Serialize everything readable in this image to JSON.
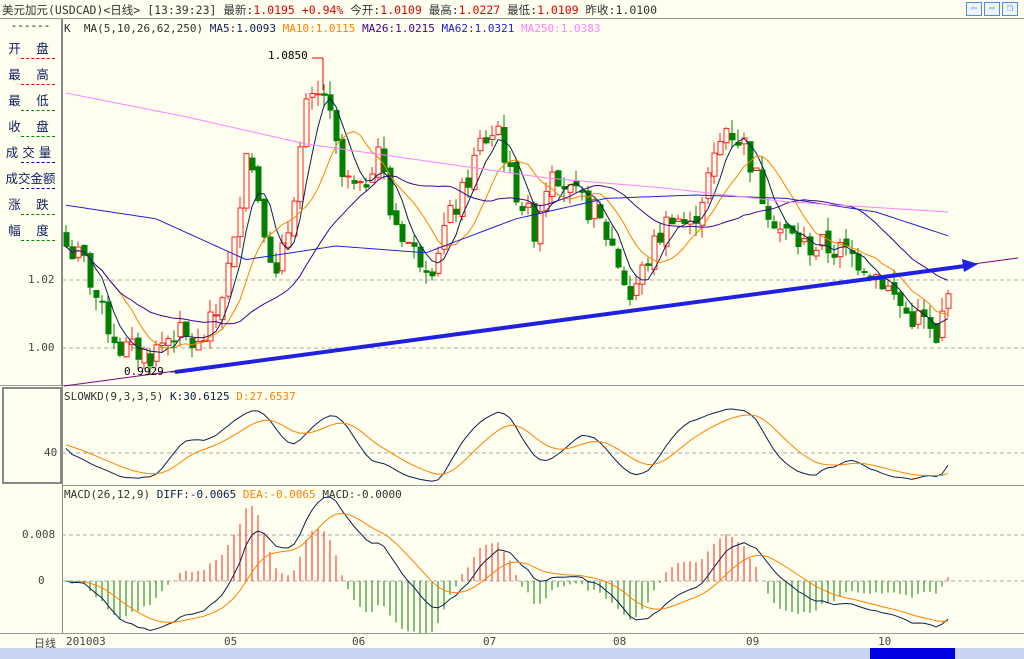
{
  "title": {
    "name": "美元加元(USDCAD)<日线>",
    "time": "[13:39:23]",
    "latest_label": "最新:",
    "latest": "1.0195",
    "change": "+0.94%",
    "open_label": "今开:",
    "open": "1.0109",
    "high_label": "最高:",
    "high": "1.0227",
    "low_label": "最低:",
    "low": "1.0109",
    "prev_label": "昨收:",
    "prev": "1.0100"
  },
  "nav": {
    "back": "⇦",
    "forward": "⇨",
    "restore": "❐"
  },
  "left_panel": {
    "dash": "------",
    "items": [
      "开 盘",
      "最 高",
      "最 低",
      "收 盘",
      "成交量",
      "成交金额",
      "涨 跌",
      "幅 度"
    ]
  },
  "main_legend": {
    "k": "K",
    "ma": "MA(5,10,26,62,250)",
    "ma5": "MA5:1.0093",
    "ma10": "MA10:1.0115",
    "ma26": "MA26:1.0215",
    "ma62": "MA62:1.0321",
    "ma250": "MA250:1.0383"
  },
  "price_axis": [
    "1.02",
    "1.00"
  ],
  "annotations": {
    "high": "1.0850",
    "low": "0.9929"
  },
  "kd": {
    "legend": "SLOWKD(9,3,3,5)",
    "k": "K:30.6125",
    "d": "D:27.6537",
    "axis": "40"
  },
  "macd": {
    "legend": "MACD(26,12,9)",
    "diff": "DIFF:-0.0065",
    "dea": "DEA:-0.0065",
    "macd": "MACD:-0.0000",
    "axis": [
      "0.008",
      "0"
    ]
  },
  "date_axis": {
    "label": "日线",
    "ticks": [
      "201003",
      "05",
      "06",
      "07",
      "08",
      "09",
      "10"
    ]
  },
  "colors": {
    "up": "#ff2020",
    "down": "#008000",
    "ma5": "#0a2050",
    "ma10": "#ff8000",
    "ma26": "#400090",
    "ma62": "#2020d0",
    "ma250": "#ff80ff",
    "trend": "#2020e0"
  },
  "chart_data": {
    "type": "candlestick",
    "close_keypoints": [
      [
        0,
        1.03
      ],
      [
        3,
        1.025
      ],
      [
        6,
        1.01
      ],
      [
        9,
        1.0
      ],
      [
        14,
        0.998
      ],
      [
        18,
        1.005
      ],
      [
        22,
        1.0
      ],
      [
        25,
        1.01
      ],
      [
        28,
        1.03
      ],
      [
        30,
        1.06
      ],
      [
        32,
        1.045
      ],
      [
        35,
        1.02
      ],
      [
        37,
        1.035
      ],
      [
        40,
        1.07
      ],
      [
        43,
        1.075
      ],
      [
        46,
        1.05
      ],
      [
        49,
        1.045
      ],
      [
        52,
        1.06
      ],
      [
        54,
        1.04
      ],
      [
        58,
        1.028
      ],
      [
        61,
        1.025
      ],
      [
        63,
        1.035
      ],
      [
        66,
        1.045
      ],
      [
        69,
        1.06
      ],
      [
        72,
        1.065
      ],
      [
        74,
        1.05
      ],
      [
        78,
        1.035
      ],
      [
        81,
        1.055
      ],
      [
        84,
        1.045
      ],
      [
        88,
        1.04
      ],
      [
        91,
        1.03
      ],
      [
        94,
        1.015
      ],
      [
        98,
        1.03
      ],
      [
        101,
        1.04
      ],
      [
        104,
        1.035
      ],
      [
        107,
        1.05
      ],
      [
        110,
        1.065
      ],
      [
        113,
        1.06
      ],
      [
        116,
        1.045
      ],
      [
        119,
        1.035
      ],
      [
        123,
        1.03
      ],
      [
        126,
        1.03
      ],
      [
        130,
        1.028
      ],
      [
        133,
        1.025
      ],
      [
        136,
        1.02
      ],
      [
        140,
        1.01
      ],
      [
        143,
        1.008
      ],
      [
        145,
        1.0
      ],
      [
        147,
        1.0195
      ]
    ],
    "ma250_keypoints": [
      [
        0,
        1.075
      ],
      [
        20,
        1.068
      ],
      [
        40,
        1.06
      ],
      [
        60,
        1.055
      ],
      [
        80,
        1.05
      ],
      [
        100,
        1.047
      ],
      [
        120,
        1.043
      ],
      [
        147,
        1.04
      ]
    ],
    "ma62_keypoints": [
      [
        0,
        1.042
      ],
      [
        15,
        1.038
      ],
      [
        30,
        1.026
      ],
      [
        45,
        1.03
      ],
      [
        60,
        1.028
      ],
      [
        75,
        1.038
      ],
      [
        90,
        1.044
      ],
      [
        105,
        1.045
      ],
      [
        120,
        1.044
      ],
      [
        135,
        1.04
      ],
      [
        147,
        1.033
      ]
    ],
    "ylim": [
      0.99,
      1.095
    ]
  }
}
